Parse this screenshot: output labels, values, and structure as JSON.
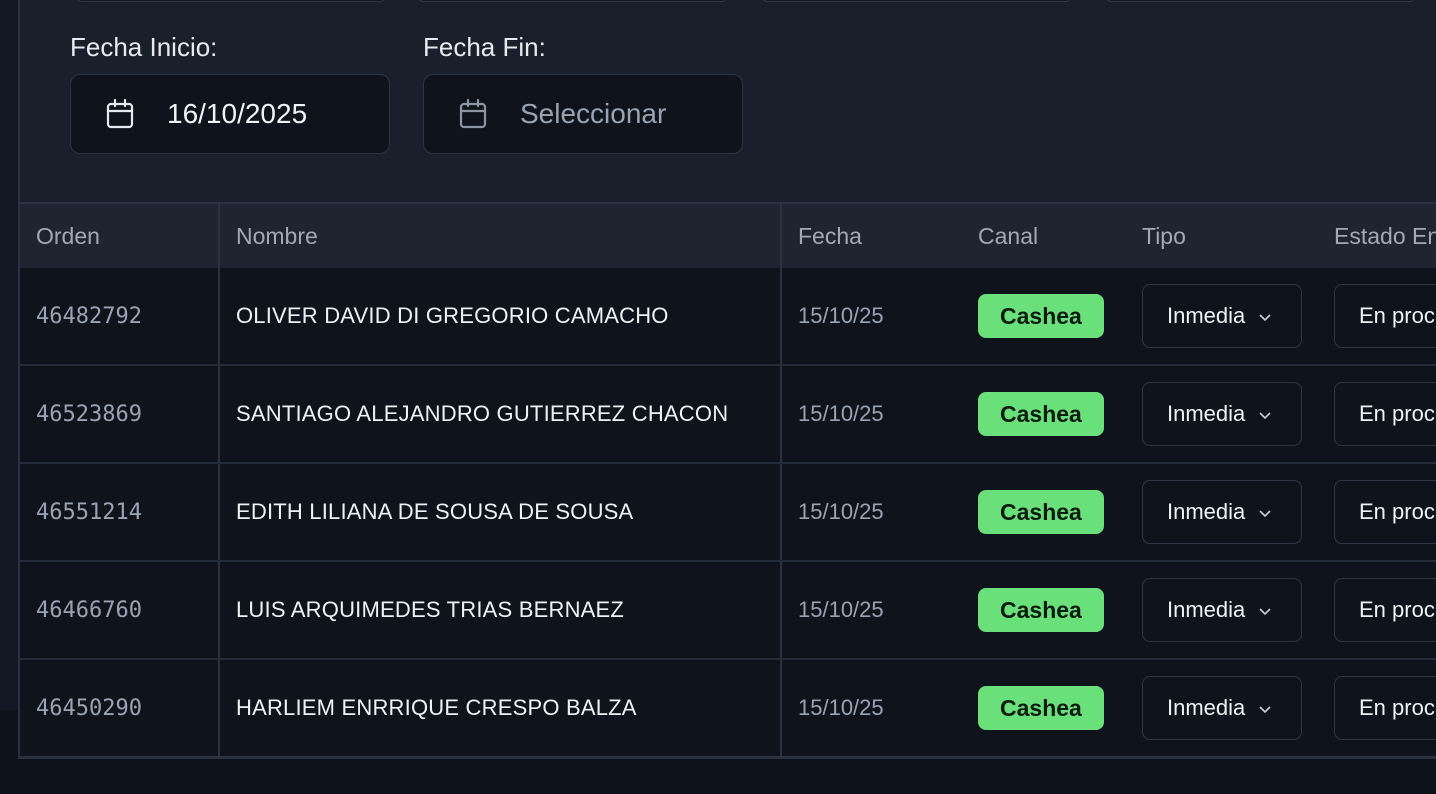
{
  "filters": {
    "start_label": "Fecha Inicio:",
    "start_value": "16/10/2025",
    "end_label": "Fecha Fin:",
    "end_placeholder": "Seleccionar",
    "icon": "calendar-icon"
  },
  "table": {
    "headers": {
      "orden": "Orden",
      "nombre": "Nombre",
      "fecha": "Fecha",
      "canal": "Canal",
      "tipo": "Tipo",
      "estado": "Estado En"
    },
    "rows": [
      {
        "orden": "46482792",
        "nombre": "OLIVER DAVID DI GREGORIO CAMACHO",
        "fecha": "15/10/25",
        "canal": "Cashea",
        "tipo": "Inmedia",
        "estado": "En proc"
      },
      {
        "orden": "46523869",
        "nombre": "SANTIAGO ALEJANDRO GUTIERREZ CHACON",
        "fecha": "15/10/25",
        "canal": "Cashea",
        "tipo": "Inmedia",
        "estado": "En proc"
      },
      {
        "orden": "46551214",
        "nombre": "EDITH LILIANA DE SOUSA DE SOUSA",
        "fecha": "15/10/25",
        "canal": "Cashea",
        "tipo": "Inmedia",
        "estado": "En proc"
      },
      {
        "orden": "46466760",
        "nombre": "LUIS ARQUIMEDES TRIAS BERNAEZ",
        "fecha": "15/10/25",
        "canal": "Cashea",
        "tipo": "Inmedia",
        "estado": "En proc"
      },
      {
        "orden": "46450290",
        "nombre": "HARLIEM ENRRIQUE CRESPO BALZA",
        "fecha": "15/10/25",
        "canal": "Cashea",
        "tipo": "Inmedia",
        "estado": "En proc"
      }
    ]
  },
  "colors": {
    "badge_bg": "#69e07a",
    "panel_bg": "#1a202b",
    "row_bg": "#0f141c"
  }
}
